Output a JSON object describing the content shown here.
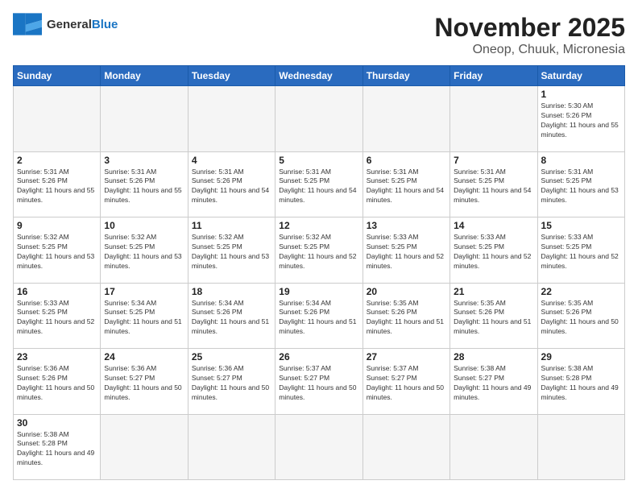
{
  "logo": {
    "text_general": "General",
    "text_blue": "Blue"
  },
  "title": {
    "month": "November 2025",
    "location": "Oneop, Chuuk, Micronesia"
  },
  "weekdays": [
    "Sunday",
    "Monday",
    "Tuesday",
    "Wednesday",
    "Thursday",
    "Friday",
    "Saturday"
  ],
  "days": [
    {
      "num": "",
      "info": ""
    },
    {
      "num": "",
      "info": ""
    },
    {
      "num": "",
      "info": ""
    },
    {
      "num": "",
      "info": ""
    },
    {
      "num": "",
      "info": ""
    },
    {
      "num": "",
      "info": ""
    },
    {
      "num": "1",
      "info": "Sunrise: 5:30 AM\nSunset: 5:26 PM\nDaylight: 11 hours and 55 minutes."
    },
    {
      "num": "2",
      "info": "Sunrise: 5:31 AM\nSunset: 5:26 PM\nDaylight: 11 hours and 55 minutes."
    },
    {
      "num": "3",
      "info": "Sunrise: 5:31 AM\nSunset: 5:26 PM\nDaylight: 11 hours and 55 minutes."
    },
    {
      "num": "4",
      "info": "Sunrise: 5:31 AM\nSunset: 5:26 PM\nDaylight: 11 hours and 54 minutes."
    },
    {
      "num": "5",
      "info": "Sunrise: 5:31 AM\nSunset: 5:25 PM\nDaylight: 11 hours and 54 minutes."
    },
    {
      "num": "6",
      "info": "Sunrise: 5:31 AM\nSunset: 5:25 PM\nDaylight: 11 hours and 54 minutes."
    },
    {
      "num": "7",
      "info": "Sunrise: 5:31 AM\nSunset: 5:25 PM\nDaylight: 11 hours and 54 minutes."
    },
    {
      "num": "8",
      "info": "Sunrise: 5:31 AM\nSunset: 5:25 PM\nDaylight: 11 hours and 53 minutes."
    },
    {
      "num": "9",
      "info": "Sunrise: 5:32 AM\nSunset: 5:25 PM\nDaylight: 11 hours and 53 minutes."
    },
    {
      "num": "10",
      "info": "Sunrise: 5:32 AM\nSunset: 5:25 PM\nDaylight: 11 hours and 53 minutes."
    },
    {
      "num": "11",
      "info": "Sunrise: 5:32 AM\nSunset: 5:25 PM\nDaylight: 11 hours and 53 minutes."
    },
    {
      "num": "12",
      "info": "Sunrise: 5:32 AM\nSunset: 5:25 PM\nDaylight: 11 hours and 52 minutes."
    },
    {
      "num": "13",
      "info": "Sunrise: 5:33 AM\nSunset: 5:25 PM\nDaylight: 11 hours and 52 minutes."
    },
    {
      "num": "14",
      "info": "Sunrise: 5:33 AM\nSunset: 5:25 PM\nDaylight: 11 hours and 52 minutes."
    },
    {
      "num": "15",
      "info": "Sunrise: 5:33 AM\nSunset: 5:25 PM\nDaylight: 11 hours and 52 minutes."
    },
    {
      "num": "16",
      "info": "Sunrise: 5:33 AM\nSunset: 5:25 PM\nDaylight: 11 hours and 52 minutes."
    },
    {
      "num": "17",
      "info": "Sunrise: 5:34 AM\nSunset: 5:25 PM\nDaylight: 11 hours and 51 minutes."
    },
    {
      "num": "18",
      "info": "Sunrise: 5:34 AM\nSunset: 5:26 PM\nDaylight: 11 hours and 51 minutes."
    },
    {
      "num": "19",
      "info": "Sunrise: 5:34 AM\nSunset: 5:26 PM\nDaylight: 11 hours and 51 minutes."
    },
    {
      "num": "20",
      "info": "Sunrise: 5:35 AM\nSunset: 5:26 PM\nDaylight: 11 hours and 51 minutes."
    },
    {
      "num": "21",
      "info": "Sunrise: 5:35 AM\nSunset: 5:26 PM\nDaylight: 11 hours and 51 minutes."
    },
    {
      "num": "22",
      "info": "Sunrise: 5:35 AM\nSunset: 5:26 PM\nDaylight: 11 hours and 50 minutes."
    },
    {
      "num": "23",
      "info": "Sunrise: 5:36 AM\nSunset: 5:26 PM\nDaylight: 11 hours and 50 minutes."
    },
    {
      "num": "24",
      "info": "Sunrise: 5:36 AM\nSunset: 5:27 PM\nDaylight: 11 hours and 50 minutes."
    },
    {
      "num": "25",
      "info": "Sunrise: 5:36 AM\nSunset: 5:27 PM\nDaylight: 11 hours and 50 minutes."
    },
    {
      "num": "26",
      "info": "Sunrise: 5:37 AM\nSunset: 5:27 PM\nDaylight: 11 hours and 50 minutes."
    },
    {
      "num": "27",
      "info": "Sunrise: 5:37 AM\nSunset: 5:27 PM\nDaylight: 11 hours and 50 minutes."
    },
    {
      "num": "28",
      "info": "Sunrise: 5:38 AM\nSunset: 5:27 PM\nDaylight: 11 hours and 49 minutes."
    },
    {
      "num": "29",
      "info": "Sunrise: 5:38 AM\nSunset: 5:28 PM\nDaylight: 11 hours and 49 minutes."
    },
    {
      "num": "30",
      "info": "Sunrise: 5:38 AM\nSunset: 5:28 PM\nDaylight: 11 hours and 49 minutes."
    },
    {
      "num": "",
      "info": ""
    },
    {
      "num": "",
      "info": ""
    },
    {
      "num": "",
      "info": ""
    },
    {
      "num": "",
      "info": ""
    },
    {
      "num": "",
      "info": ""
    },
    {
      "num": "",
      "info": ""
    },
    {
      "num": "",
      "info": ""
    },
    {
      "num": "",
      "info": ""
    }
  ]
}
